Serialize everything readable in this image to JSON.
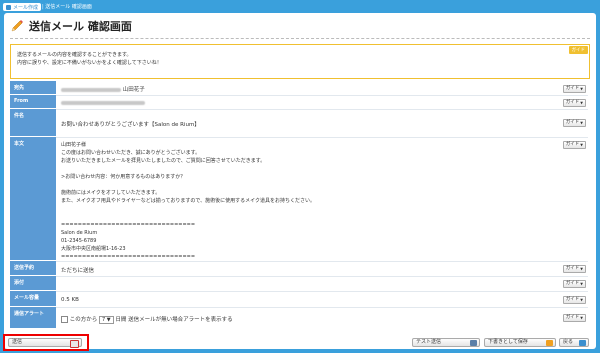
{
  "topbar": {
    "tab_label": "メール作成",
    "breadcrumb": "| 送信メール 確認画面"
  },
  "page": {
    "title": "送信メール 確認画面"
  },
  "notice": {
    "line1": "送信するメールの内容を確認することができます。",
    "line2": "内容に誤りや、設定に不備いがないかをよく確認して下さいね！",
    "guide_label": "ガイド"
  },
  "guide_label": "ガイド",
  "rows": {
    "to": {
      "label": "宛先",
      "name": "山田花子"
    },
    "from": {
      "label": "From"
    },
    "subject": {
      "label": "件名",
      "value": "お問い合わせありがとうございます【Salon de Rium】"
    },
    "body": {
      "label": "本文",
      "lines": [
        "山田花子様",
        "この度はお問い合わせいただき、誠にありがとうございます。",
        "お送りいただきましたメールを拝見いたしましたので、ご質問に回答させていただきます。",
        "",
        ">お問い合わせ内容：何か用意するものはありますか？",
        "",
        "施術前にはメイクをオフしていただきます。",
        "また、メイクオフ用具やドライヤーなどは揃っておりますので、施術後に使用するメイク道具をお持ちください。",
        "",
        "",
        "================================",
        "Salon de Rium",
        "01-2345-6789",
        "大阪市中央区南船場1-16-23",
        "================================"
      ]
    },
    "schedule": {
      "label": "送信予約",
      "value": "ただちに送信"
    },
    "attach": {
      "label": "添付"
    },
    "size": {
      "label": "メール容量",
      "value": "0.5 KB"
    },
    "alert": {
      "label": "通信アラート",
      "prefix": "この方から",
      "days": "7",
      "suffix": "日間 送信メールが無い場合アラートを表示する"
    }
  },
  "footer": {
    "send_label": "送信",
    "test_send_label": "テスト送信",
    "save_draft_label": "下書きとして保存",
    "back_label": "戻る"
  },
  "colors": {
    "brand_blue": "#3aa0dc",
    "label_blue": "#5b9ad4",
    "notice_yellow": "#f0c030",
    "highlight_red": "#e00000"
  }
}
